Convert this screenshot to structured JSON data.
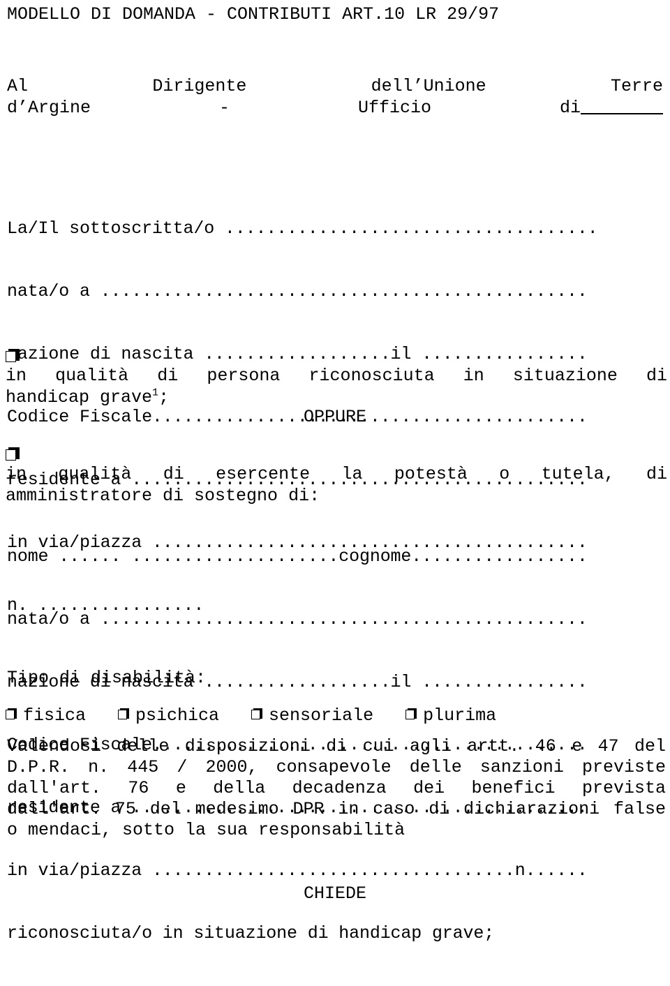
{
  "document": {
    "title": "MODELLO DI DOMANDA - CONTRIBUTI ART.10 LR 29/97",
    "addressee": {
      "line1": "Al Dirigente dell’Unione Terre",
      "line2_prefix": "d’Argine - Ufficio di"
    },
    "applicant_fields": {
      "line1": "La/Il sottoscritta/o ....................................",
      "line2": "nata/o a ...............................................",
      "line3": "nazione di nascita ..................il ................",
      "line4": "Codice Fiscale..........................................",
      "line5": "residente a ............................................",
      "line6": "in via/piazza ..........................................",
      "line7": "n. ................"
    },
    "option_a": {
      "checkbox": "unchecked",
      "line1": "in qualità di persona riconosciuta in situazione di",
      "line2_text": "handicap grave",
      "line2_footnote": "1",
      "line2_suffix": ";"
    },
    "separator": "OPPURE",
    "option_b": {
      "checkbox": "unchecked",
      "line1": "in qualità di esercente la potestà o tutela, di",
      "line2": "amministratore di sostegno di:"
    },
    "beneficiary_fields": {
      "line1": "nome ...... ....................cognome.................",
      "line2": "nata/o a ...............................................",
      "line3": "nazione di nascita ..................il ................",
      "line4": "Codice Fiscale..........................................",
      "line5": "residente a ............................................",
      "line6": "in via/piazza ...................................n......",
      "line7": "riconosciuta/o in situazione di handicap grave;"
    },
    "disability": {
      "heading": "Tipo di disabilità:",
      "options": [
        {
          "label": "fisica",
          "checkbox": "unchecked"
        },
        {
          "label": "psichica",
          "checkbox": "unchecked"
        },
        {
          "label": "sensoriale",
          "checkbox": "unchecked"
        },
        {
          "label": "plurima",
          "checkbox": "unchecked"
        }
      ]
    },
    "legal_declaration": {
      "line1": "Valendosi delle disposizioni di cui agli artt. 46 e 47 del",
      "line2": "D.P.R. n. 445 / 2000, consapevole delle sanzioni previste",
      "line3": "dall'art. 76 e della decadenza dei benefici prevista",
      "line4": "dall'art. 75 del medesimo DPR in caso di dichiarazioni false",
      "line5": "o mendaci, sotto la sua responsabilità"
    },
    "request_heading": "CHIEDE"
  }
}
